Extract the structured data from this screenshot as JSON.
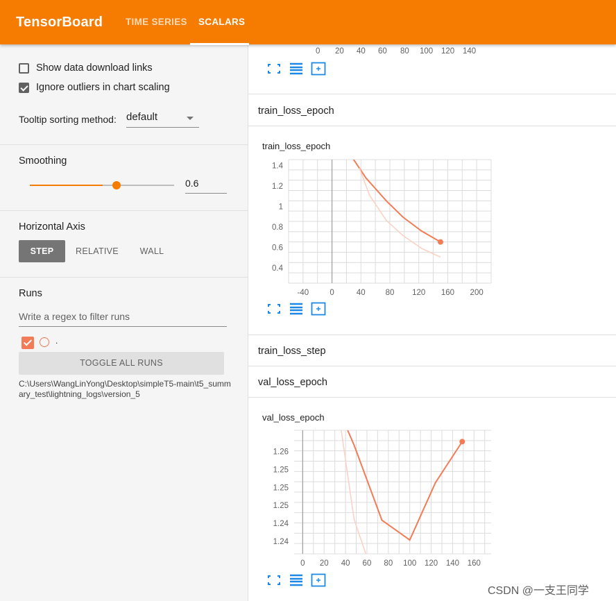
{
  "header": {
    "brand": "TensorBoard",
    "tabs": [
      {
        "label": "TIME SERIES"
      },
      {
        "label": "SCALARS"
      }
    ],
    "active_tab": "SCALARS"
  },
  "sidebar": {
    "show_download_links": {
      "label": "Show data download links",
      "checked": false
    },
    "ignore_outliers": {
      "label": "Ignore outliers in chart scaling",
      "checked": true
    },
    "tooltip": {
      "label": "Tooltip sorting method:",
      "value": "default"
    },
    "smoothing": {
      "title": "Smoothing",
      "value": "0.6",
      "level": 0.6
    },
    "horizontal_axis": {
      "title": "Horizontal Axis",
      "options": [
        "STEP",
        "RELATIVE",
        "WALL"
      ],
      "selected": "STEP"
    },
    "runs": {
      "title": "Runs",
      "filter_placeholder": "Write a regex to filter runs",
      "run_name": ".",
      "toggle_label": "TOGGLE ALL RUNS",
      "path": "C:\\Users\\WangLinYong\\Desktop\\simpleT5-main\\t5_summary_test\\lightning_logs\\version_5"
    }
  },
  "top_axis_ticks": [
    "0",
    "20",
    "40",
    "60",
    "80",
    "100",
    "120",
    "140"
  ],
  "groups": {
    "train_loss_epoch": "train_loss_epoch",
    "train_loss_step": "train_loss_step",
    "val_loss_epoch": "val_loss_epoch"
  },
  "colors": {
    "accent": "#f57c00",
    "run": "#f17c56",
    "run_light": "#fbd2c4"
  },
  "watermark": "CSDN @一支王同学",
  "chart_data": [
    {
      "type": "line",
      "title": "train_loss_epoch",
      "x_ticks": [
        -40,
        0,
        40,
        80,
        120,
        160,
        200
      ],
      "y_ticks": [
        "0.4",
        "0.6",
        "0.8",
        "1",
        "1.2",
        "1.4"
      ],
      "xlim": [
        -60,
        220
      ],
      "ylim": [
        0.32,
        1.46
      ],
      "grid": true,
      "series": [
        {
          "smoothed": true,
          "x": [
            28,
            47,
            75,
            98,
            124,
            150
          ],
          "y": [
            1.48,
            1.29,
            1.08,
            0.93,
            0.8,
            0.7
          ]
        },
        {
          "smoothed": false,
          "x": [
            38,
            52,
            75,
            98,
            124,
            150
          ],
          "y": [
            1.38,
            1.13,
            0.9,
            0.76,
            0.64,
            0.56
          ]
        }
      ]
    },
    {
      "type": "line",
      "title": "val_loss_epoch",
      "x_ticks": [
        0,
        20,
        40,
        60,
        80,
        100,
        120,
        140,
        160
      ],
      "y_ticks": [
        "1.24",
        "1.24",
        "1.25",
        "1.25",
        "1.25",
        "1.26"
      ],
      "xlim": [
        -8,
        176
      ],
      "ylim": [
        1.2375,
        1.2625
      ],
      "grid": true,
      "series": [
        {
          "smoothed": true,
          "x": [
            42,
            48,
            74,
            100,
            124,
            149
          ],
          "y": [
            1.2625,
            1.2595,
            1.2443,
            1.2403,
            1.2519,
            1.2602
          ]
        },
        {
          "smoothed": false,
          "x": [
            36,
            48,
            60
          ],
          "y": [
            1.2625,
            1.2445,
            1.2368
          ]
        }
      ]
    }
  ]
}
